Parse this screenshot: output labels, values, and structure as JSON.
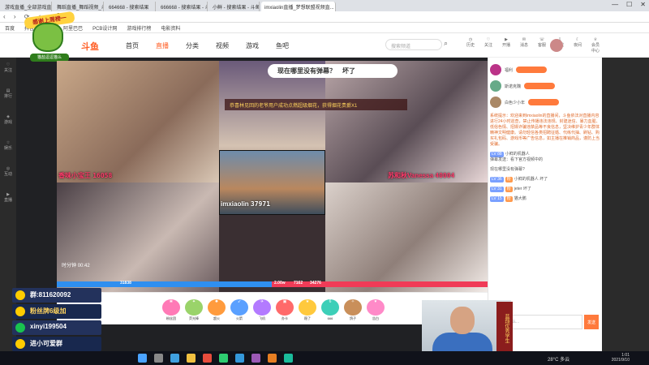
{
  "browser": {
    "tabs": [
      "游戏直播_全部游戏直播_斗鱼直",
      "舞蹈直播_舞蹈视频_斗鱼直播",
      "664668 - 搜索结果",
      "666668 - 搜索结果 - 斗鱼直播",
      "小鲜 - 搜索结果 - 斗鱼直播",
      "imxiaolin直播_梦想联盟视频直..."
    ],
    "url": "99710",
    "bookmarks": [
      "百度",
      "抖音",
      "优酷",
      "阿里巴巴",
      "PCB设计网",
      "游戏排行榜",
      "电影资料"
    ]
  },
  "overlay": {
    "banner": "感谢上周榜一",
    "apple_label": "猫盐逗逗猫么"
  },
  "header": {
    "logo": "斗鱼",
    "nav": [
      "首页",
      "直播",
      "分类",
      "视频",
      "游戏",
      "鱼吧"
    ],
    "search_placeholder": "搜索频道",
    "icons": [
      "历史",
      "关注",
      "开播",
      "消息",
      "客服",
      "下载",
      "夜间",
      "会员中心"
    ]
  },
  "sidebar": [
    "关注",
    "排行",
    "游戏",
    "娱乐",
    "互动",
    "直播"
  ],
  "video": {
    "question": "现在哪里没有弹幕？",
    "question_suffix": "坏了",
    "message": "恭喜林见回的老爷用户成功点燃超级烟花，获得烟花贵爵X1",
    "names": [
      {
        "name": "香味小宝王",
        "score": "16058"
      },
      {
        "name": "苏和秋Vanessa",
        "score": "40004"
      },
      {
        "name": "imxiaolin",
        "score": "37971"
      }
    ],
    "timer_label": "时分钟",
    "timer": "00:42",
    "pk_left": "31838",
    "pk_right": "34276",
    "pk_mid_l": "2.00w",
    "pk_mid_r": "7162"
  },
  "gifts": [
    "粉丝团",
    "荧光棒",
    "超火",
    "火箭",
    "飞机",
    "办卡",
    "稳了",
    "666",
    "鸽子",
    "告白"
  ],
  "left_overlay": [
    {
      "text": "群:811620092"
    },
    {
      "text": "粉丝牌6级加"
    },
    {
      "text": "xinyi199504"
    },
    {
      "text": "进小可爱群"
    }
  ],
  "chat": {
    "rank": [
      {
        "user": "福利"
      },
      {
        "user": "斯诺克魏"
      },
      {
        "user": "白色少小年"
      }
    ],
    "lines": [
      {
        "text": "系统提示：欢迎来到imxiaolin的直播间，斗鱼依法对直播内容进行24小时巡查，禁止传播违法违规、封建迷信、暴力血腥、低俗色情、招嫖诈骗违禁品等不良信息，坚决维护青少年群体精神文明健康。请勿轻信各类招聘征婚、代练代抽、刷钻、购买礼包码、游戏币等广告信息，如主播在推销商品，谨防上当受骗。"
      },
      {
        "lv": "LV 88",
        "user": "小鲜的机器人",
        "text": "弹幕发送：看下官方视频中的"
      },
      {
        "text": "现在哪里没有弹幕?"
      },
      {
        "lv": "LV 36",
        "user": "小鲜的机器人",
        "text": "坏了"
      },
      {
        "lv": "LV 31",
        "user": "jeter",
        "text": "坏了"
      },
      {
        "lv": "LV 15",
        "user": "猫大鹏",
        "text": ""
      }
    ],
    "input_placeholder": "想说点什么...",
    "send_label": "发送"
  },
  "webcam": {
    "scroll_text": "蓝翔优秀学生"
  },
  "taskbar": {
    "weather": "28°C 多云",
    "time": "1:01",
    "date": "2021/9/10"
  }
}
